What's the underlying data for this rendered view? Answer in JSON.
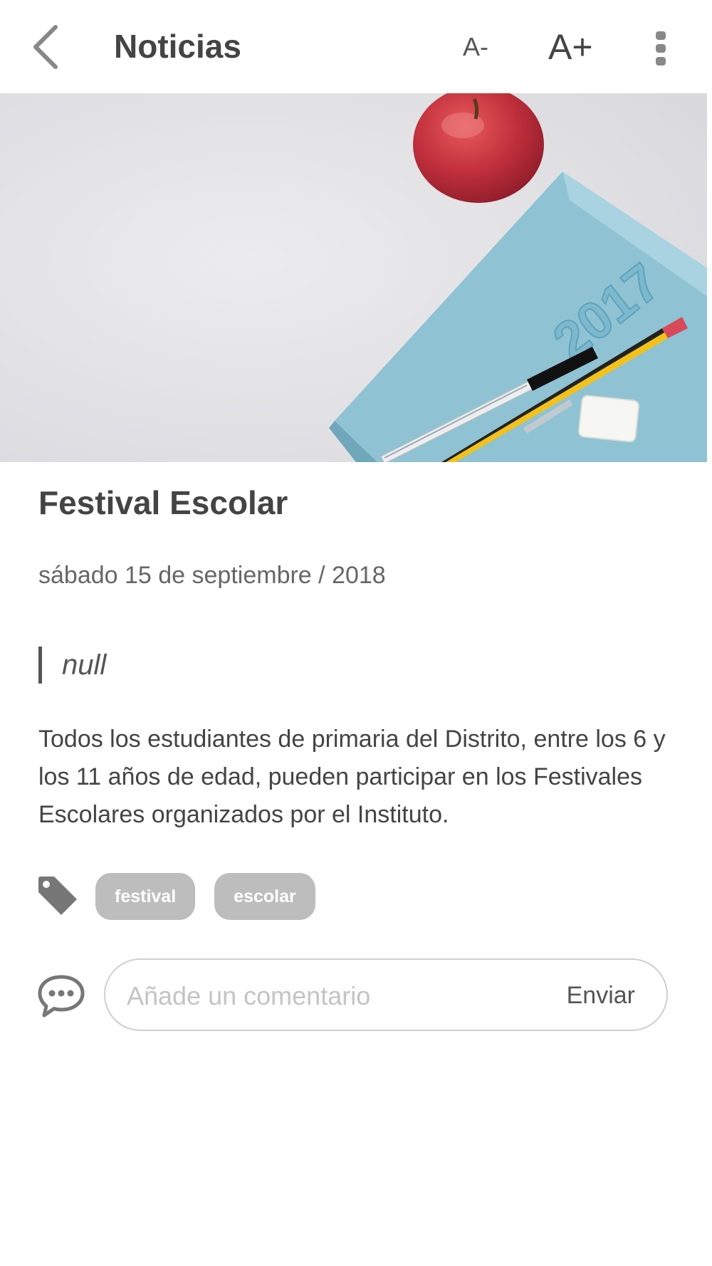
{
  "header": {
    "title": "Noticias",
    "font_decrease_label": "A-",
    "font_increase_label": "A+",
    "icons": [
      "chevron-left-icon",
      "more-vertical-icon"
    ]
  },
  "hero_image": {
    "subject": "notebook-apple-pen-pencil-photo",
    "notebook_text": "2017"
  },
  "article": {
    "title": "Festival Escolar",
    "date": "sábado 15 de septiembre / 2018",
    "quote": "null",
    "body": "Todos los estudiantes de primaria del Distrito, entre los 6 y los 11 años de edad, pueden participar en los Festivales Escolares organizados por el Instituto.",
    "tags": [
      "festival",
      "escolar"
    ],
    "tag_icon": "tag-icon"
  },
  "comment": {
    "placeholder": "Añade un comentario",
    "value": "",
    "send_label": "Enviar",
    "icon": "chat-bubble-icon"
  },
  "colors": {
    "tag_bg": "#bdbdbd",
    "icon_gray": "#777777",
    "text": "#444444"
  }
}
